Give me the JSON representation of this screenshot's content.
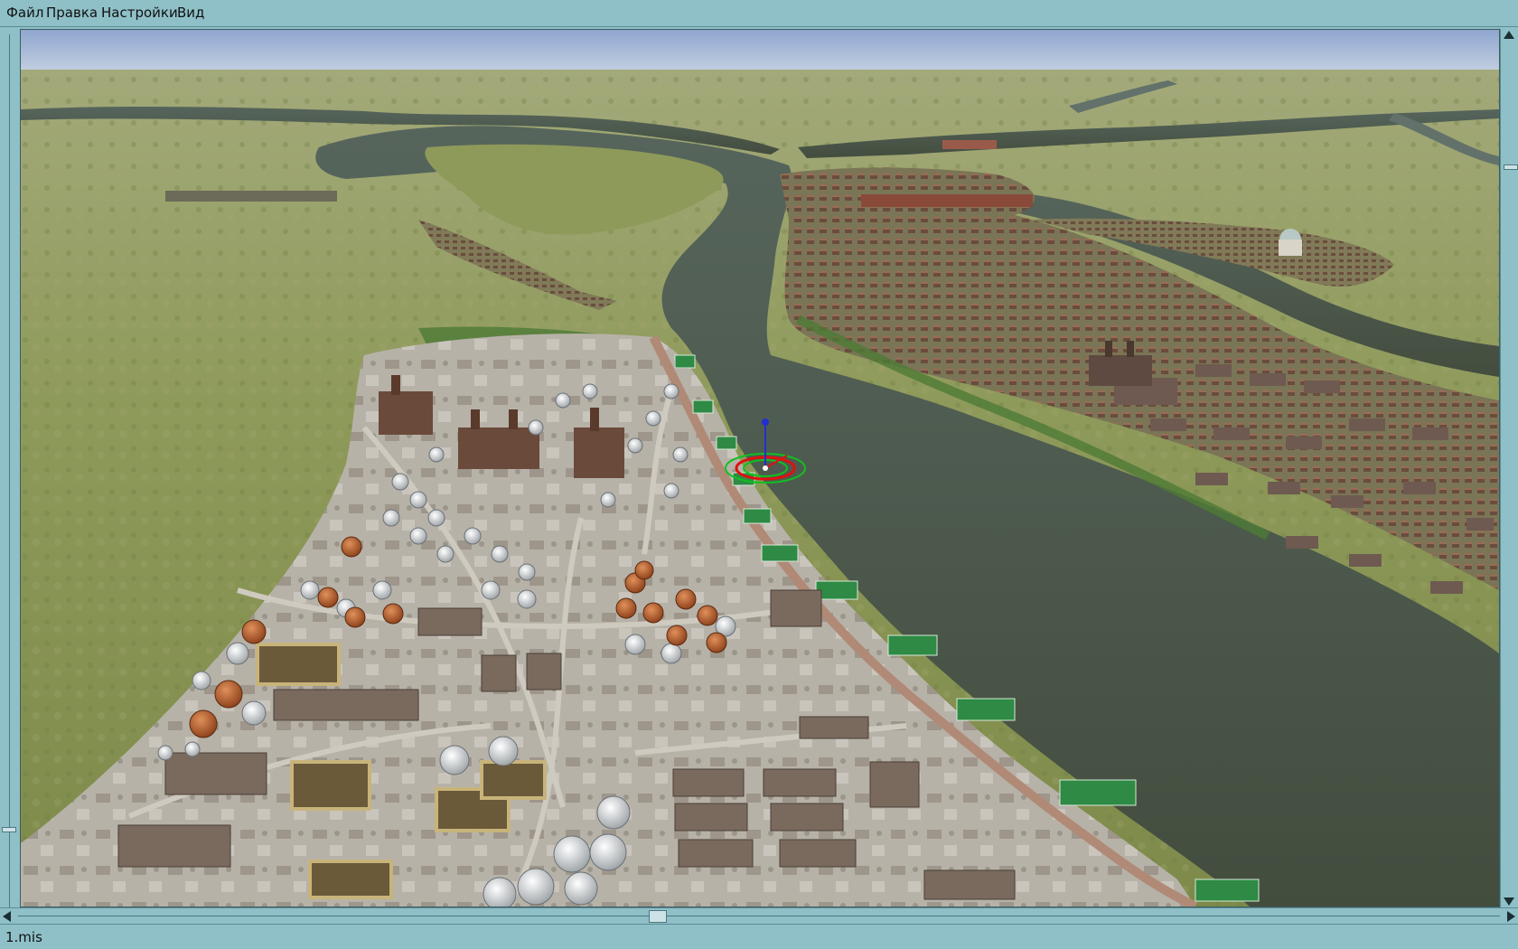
{
  "menu": {
    "file": "Файл",
    "edit": "Правка",
    "settings": "Настройки",
    "view": "Вид"
  },
  "status": {
    "filename": "1.mis"
  },
  "colors": {
    "chrome": "#8fc0c8",
    "sky": "#9fb4d4",
    "river": "#4b5748",
    "grass": "#8c9a5c",
    "cursor_red": "#e01010",
    "cursor_green": "#10c020"
  },
  "icons": {
    "selection_cursor": "target-rings-icon"
  }
}
